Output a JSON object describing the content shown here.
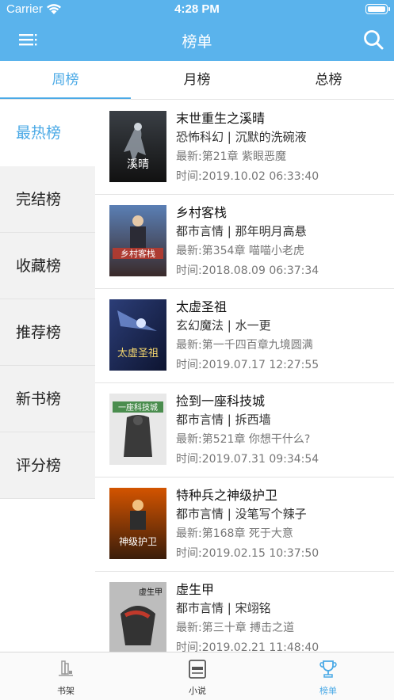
{
  "status_bar": {
    "carrier": "Carrier",
    "time": "4:28 PM"
  },
  "nav": {
    "title": "榜单",
    "left_icon": "menu-icon",
    "right_icon": "search-icon"
  },
  "tabs": [
    {
      "label": "周榜",
      "active": true
    },
    {
      "label": "月榜",
      "active": false
    },
    {
      "label": "总榜",
      "active": false
    }
  ],
  "sidebar": [
    {
      "label": "最热榜",
      "active": true
    },
    {
      "label": "完结榜",
      "active": false
    },
    {
      "label": "收藏榜",
      "active": false
    },
    {
      "label": "推荐榜",
      "active": false
    },
    {
      "label": "新书榜",
      "active": false
    },
    {
      "label": "评分榜",
      "active": false
    }
  ],
  "books": [
    {
      "title": "末世重生之溪晴",
      "meta": "恐怖科幻 | 沉默的洗碗液",
      "latest": "最新:第21章 紫眼恶魔",
      "time": "时间:2019.10.02 06:33:40",
      "cover_text": "溪晴"
    },
    {
      "title": "乡村客栈",
      "meta": "都市言情 | 那年明月高悬",
      "latest": "最新:第354章 喵喵小老虎",
      "time": "时间:2018.08.09 06:37:34",
      "cover_text": "乡村客栈"
    },
    {
      "title": "太虚圣祖",
      "meta": "玄幻魔法 | 水一更",
      "latest": "最新:第一千四百章九境圆满",
      "time": "时间:2019.07.17 12:27:55",
      "cover_text": "太虚圣祖"
    },
    {
      "title": "捡到一座科技城",
      "meta": "都市言情 | 拆西墙",
      "latest": "最新:第521章 你想干什么?",
      "time": "时间:2019.07.31 09:34:54",
      "cover_text": "一座科技城"
    },
    {
      "title": "特种兵之神级护卫",
      "meta": "都市言情 | 没笔写个辣子",
      "latest": "最新:第168章 死于大意",
      "time": "时间:2019.02.15 10:37:50",
      "cover_text": "神级护卫"
    },
    {
      "title": "虚生甲",
      "meta": "都市言情 | 宋翊铭",
      "latest": "最新:第三十章 搏击之道",
      "time": "时间:2019.02.21 11:48:40",
      "cover_text": "虚生甲"
    }
  ],
  "bottom_tabs": [
    {
      "label": "书架",
      "icon": "bookshelf-icon",
      "active": false
    },
    {
      "label": "小说",
      "icon": "novel-icon",
      "active": false
    },
    {
      "label": "榜单",
      "icon": "trophy-icon",
      "active": true
    }
  ],
  "colors": {
    "accent": "#4aa9e6",
    "nav_bg": "#5ab3ec",
    "sidebar_bg": "#f2f2f2"
  }
}
